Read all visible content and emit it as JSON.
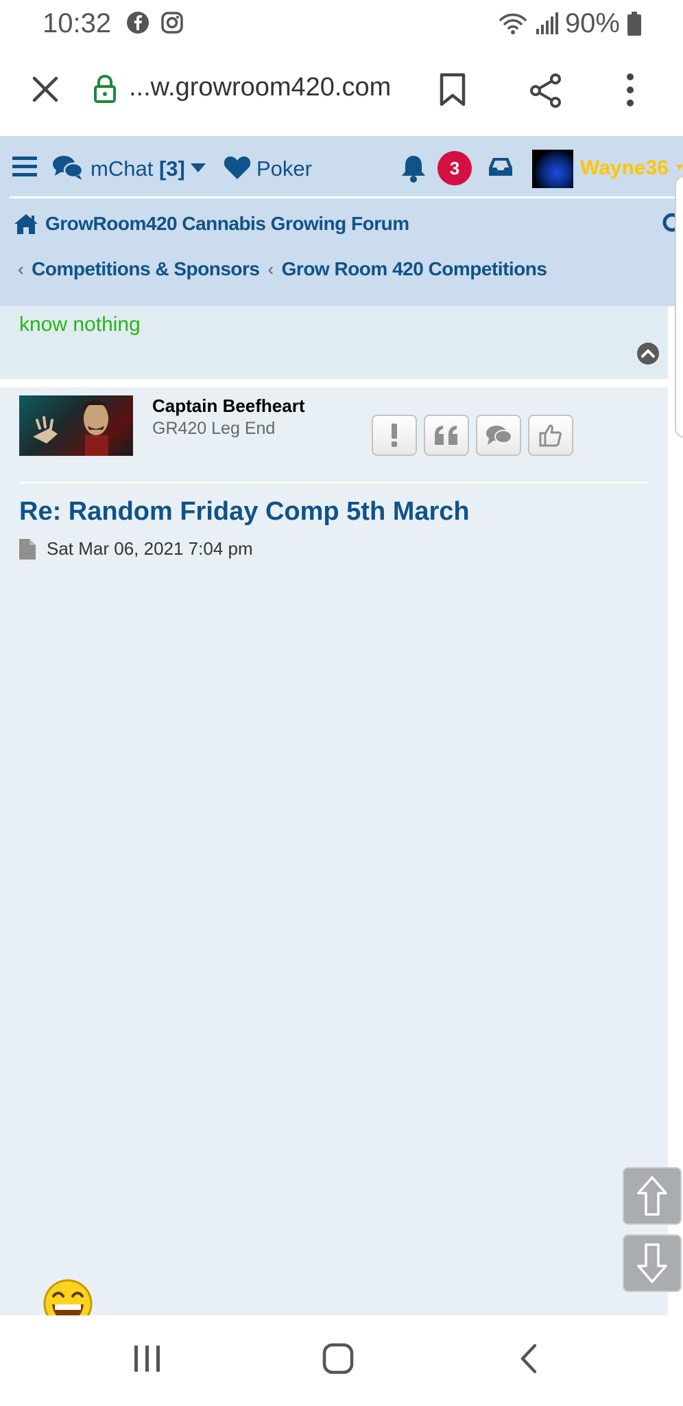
{
  "status_bar": {
    "time": "10:32",
    "battery": "90%",
    "left_icons": [
      "facebook-icon",
      "instagram-icon"
    ],
    "right_icons": [
      "wifi-icon",
      "signal-icon",
      "battery-icon"
    ]
  },
  "browser": {
    "url": "...w.growroom420.com"
  },
  "nav": {
    "mchat_label": "mChat",
    "mchat_count": "[3]",
    "poker_label": "Poker",
    "notification_count": "3",
    "username": "Wayne36"
  },
  "breadcrumbs": {
    "home": "GrowRoom420 Cannabis Growing Forum",
    "items": [
      "Competitions & Sponsors",
      "Grow Room 420 Competitions"
    ]
  },
  "previous_post": {
    "text": "know nothing"
  },
  "post": {
    "author": "Captain Beefheart",
    "rank": "GR420 Leg End",
    "title": "Re: Random Friday Comp 5th March",
    "date": "Sat Mar 06, 2021 7:04 pm",
    "buttons": [
      "report-button",
      "quote-button",
      "pm-button",
      "like-button"
    ]
  },
  "colors": {
    "link": "#105289",
    "header_bg": "#cadced",
    "post_bg": "#e9f0f5",
    "username": "#ffc600",
    "badge": "#d31141",
    "green_text": "#22b812"
  }
}
